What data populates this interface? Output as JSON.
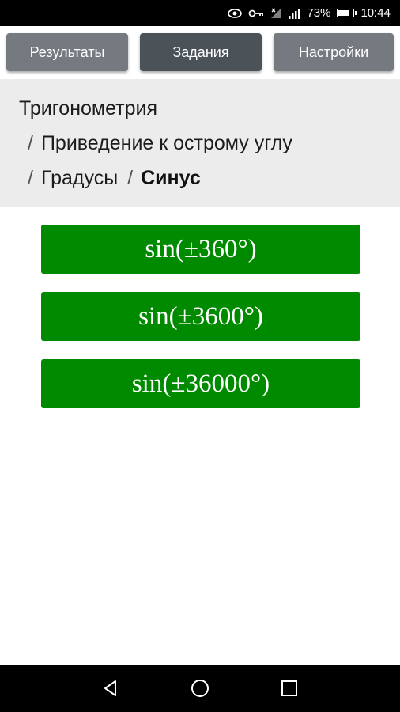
{
  "status_bar": {
    "battery_percent": "73%",
    "battery_level": 0.73,
    "time": "10:44",
    "icons": [
      "eye-icon",
      "key-icon",
      "signal-icon",
      "signal-lte-icon",
      "battery-icon"
    ]
  },
  "tabs": {
    "results": "Результаты",
    "tasks": "Задания",
    "settings": "Настройки"
  },
  "breadcrumb": {
    "level1": "Тригонометрия",
    "separator": "/",
    "level2": "Приведение к острому углу",
    "level3": "Градусы",
    "level4": "Синус"
  },
  "answers": [
    {
      "label": "sin(±360°)"
    },
    {
      "label": "sin(±3600°)"
    },
    {
      "label": "sin(±36000°)"
    }
  ],
  "colors": {
    "answer_bg": "#008a00",
    "tab_active": "#4b5258",
    "tab_inactive": "#757a80"
  },
  "nav_bar": {
    "icons": [
      "back-icon",
      "home-icon",
      "recent-apps-icon"
    ]
  }
}
